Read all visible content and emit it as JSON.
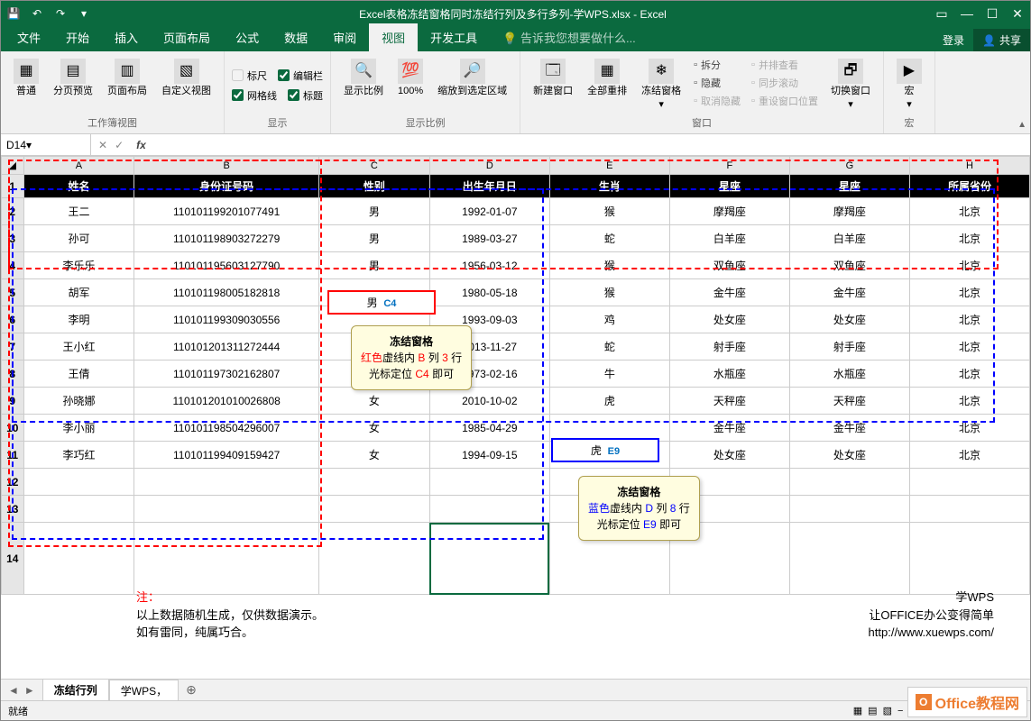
{
  "title": "Excel表格冻结窗格同时冻结行列及多行多列-学WPS.xlsx - Excel",
  "tabs": [
    "文件",
    "开始",
    "插入",
    "页面布局",
    "公式",
    "数据",
    "审阅",
    "视图",
    "开发工具"
  ],
  "active_tab": 7,
  "tell_me": "告诉我您想要做什么...",
  "login": "登录",
  "share": "共享",
  "ribbon": {
    "g1": {
      "label": "工作簿视图",
      "btns": [
        "普通",
        "分页预览",
        "页面布局",
        "自定义视图"
      ]
    },
    "g2": {
      "label": "显示",
      "chks": [
        "标尺",
        "编辑栏",
        "网格线",
        "标题"
      ]
    },
    "g3": {
      "label": "显示比例",
      "btns": [
        "显示比例",
        "100%",
        "缩放到选定区域"
      ]
    },
    "g4": {
      "label": "窗口",
      "btns": [
        "新建窗口",
        "全部重排",
        "冻结窗格"
      ],
      "small": [
        "拆分",
        "隐藏",
        "取消隐藏",
        "并排查看",
        "同步滚动",
        "重设窗口位置"
      ],
      "switch": "切换窗口"
    },
    "g5": {
      "label": "宏",
      "btn": "宏"
    }
  },
  "namebox": "D14",
  "columns": [
    "A",
    "B",
    "C",
    "D",
    "E",
    "F",
    "G",
    "H"
  ],
  "headers": [
    "姓名",
    "身份证号码",
    "性别",
    "出生年月日",
    "生肖",
    "星座",
    "星座",
    "所属省份"
  ],
  "rows": [
    {
      "r": 2,
      "d": [
        "王二",
        "110101199201077491",
        "男",
        "1992-01-07",
        "猴",
        "摩羯座",
        "摩羯座",
        "北京"
      ]
    },
    {
      "r": 3,
      "d": [
        "孙可",
        "110101198903272279",
        "男",
        "1989-03-27",
        "蛇",
        "白羊座",
        "白羊座",
        "北京"
      ]
    },
    {
      "r": 4,
      "d": [
        "李乐乐",
        "110101195603127790",
        "男",
        "1956-03-12",
        "猴",
        "双鱼座",
        "双鱼座",
        "北京"
      ]
    },
    {
      "r": 5,
      "d": [
        "胡军",
        "110101198005182818",
        "",
        "1980-05-18",
        "猴",
        "金牛座",
        "金牛座",
        "北京"
      ]
    },
    {
      "r": 6,
      "d": [
        "李明",
        "110101199309030556",
        "",
        "1993-09-03",
        "鸡",
        "处女座",
        "处女座",
        "北京"
      ]
    },
    {
      "r": 7,
      "d": [
        "王小红",
        "110101201311272444",
        "",
        "2013-11-27",
        "蛇",
        "射手座",
        "射手座",
        "北京"
      ]
    },
    {
      "r": 8,
      "d": [
        "王倩",
        "110101197302162807",
        "女",
        "1973-02-16",
        "牛",
        "水瓶座",
        "水瓶座",
        "北京"
      ]
    },
    {
      "r": 9,
      "d": [
        "孙晓娜",
        "110101201010026808",
        "女",
        "2010-10-02",
        "虎",
        "天秤座",
        "天秤座",
        "北京"
      ]
    },
    {
      "r": 10,
      "d": [
        "李小丽",
        "110101198504296007",
        "女",
        "1985-04-29",
        "",
        "金牛座",
        "金牛座",
        "北京"
      ]
    },
    {
      "r": 11,
      "d": [
        "李巧红",
        "110101199409159427",
        "女",
        "1994-09-15",
        "",
        "处女座",
        "处女座",
        "北京"
      ]
    }
  ],
  "callout1": {
    "title": "冻结窗格",
    "l2a": "红色",
    "l2b": "虚线内",
    "l2c": "B",
    "l2d": "列",
    "l2e": "3",
    "l2f": "行",
    "l3a": "光标定位",
    "l3b": "C4",
    "l3c": "即可"
  },
  "callout2": {
    "title": "冻结窗格",
    "l2a": "蓝色",
    "l2b": "虚线内",
    "l2c": "D",
    "l2d": "列",
    "l2e": "8",
    "l2f": "行",
    "l3a": "光标定位",
    "l3b": "E9",
    "l3c": "即可"
  },
  "c4_label": "C4",
  "c4_text": "男",
  "e9_label": "E9",
  "e9_text": "虎",
  "note": {
    "t": "注：",
    "l1": "以上数据随机生成，仅供数据演示。",
    "l2": "如有雷同，纯属巧合。"
  },
  "footer": {
    "l1": "学WPS",
    "l2": "让OFFICE办公变得简单",
    "l3": "http://www.xuewps.com/"
  },
  "sheets": [
    "冻结行列",
    "学WPS，"
  ],
  "active_sheet": 0,
  "status": "就绪",
  "zoom": "100%",
  "logo": "Office教程网"
}
